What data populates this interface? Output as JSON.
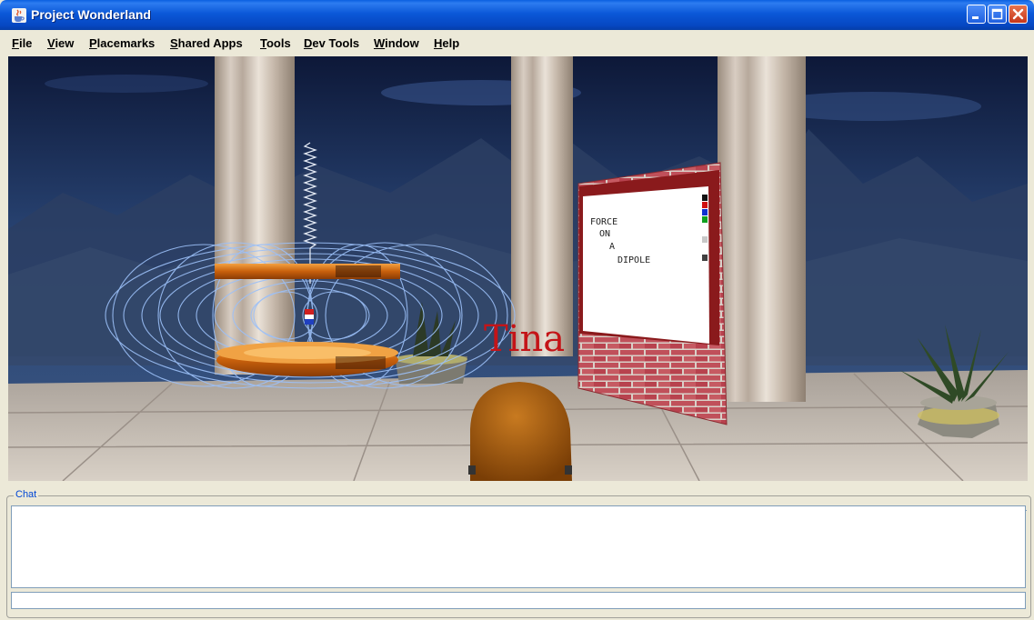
{
  "window": {
    "title": "Project Wonderland",
    "icon": "java-cup-icon",
    "controls": [
      "minimize-icon",
      "maximize-icon",
      "close-icon"
    ]
  },
  "menu": {
    "items": [
      {
        "mnemonic": "F",
        "rest": "ile"
      },
      {
        "mnemonic": "V",
        "rest": "iew"
      },
      {
        "mnemonic": "P",
        "rest": "lacemarks"
      },
      {
        "mnemonic": "S",
        "rest": "hared Apps"
      },
      {
        "mnemonic": "T",
        "rest": "ools"
      },
      {
        "mnemonic": "D",
        "rest": "ev Tools"
      },
      {
        "mnemonic": "W",
        "rest": "indow"
      },
      {
        "mnemonic": "H",
        "rest": "elp"
      }
    ]
  },
  "scene": {
    "avatar_name": "Tina",
    "whiteboard_lines": [
      "FORCE",
      "ON",
      "A",
      "DIPOLE"
    ],
    "whiteboard_palette": [
      "#111111",
      "#d01010",
      "#1030d0",
      "#10a020",
      "#c8c8c8",
      "#404040"
    ],
    "nametag_color": "#c41418"
  },
  "chat": {
    "label": "Chat",
    "log": "",
    "input": ""
  }
}
